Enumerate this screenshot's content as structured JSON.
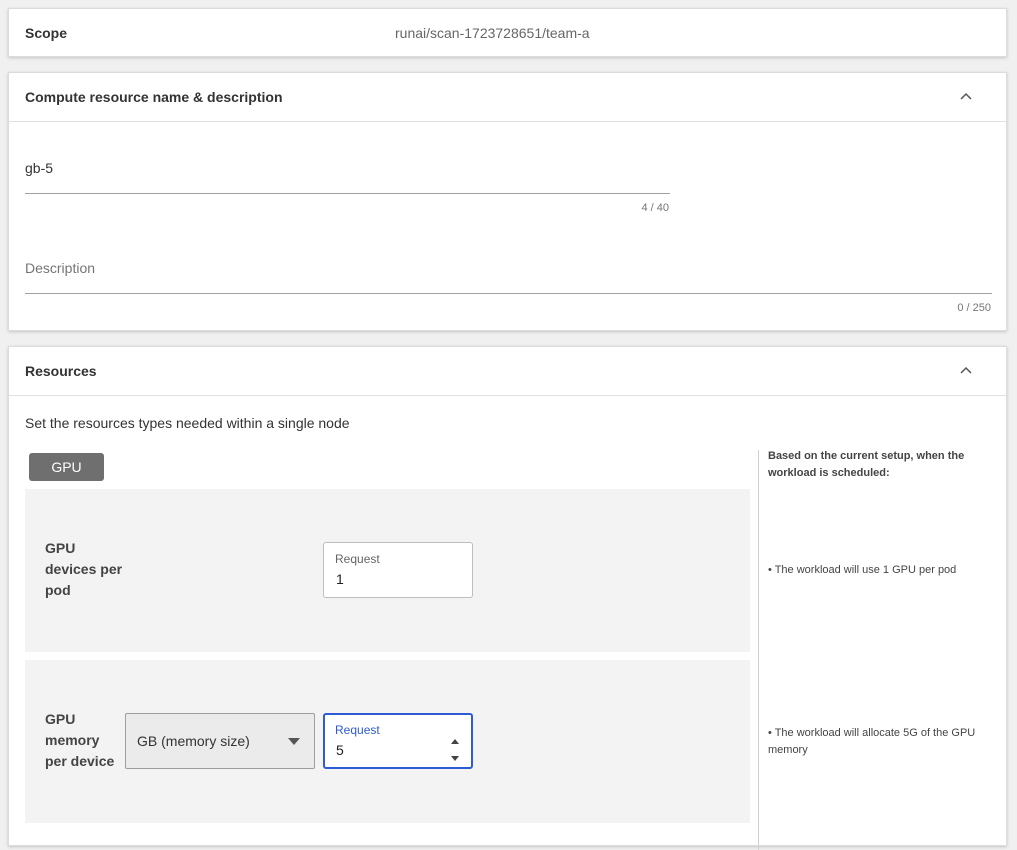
{
  "scope": {
    "label": "Scope",
    "value": "runai/scan-1723728651/team-a"
  },
  "name_section": {
    "title": "Compute resource name & description",
    "name_value": "gb-5",
    "name_counter": "4 / 40",
    "description_placeholder": "Description",
    "description_counter": "0 / 250"
  },
  "resources": {
    "title": "Resources",
    "intro": "Set the resources types needed within a single node",
    "tab_label": "GPU",
    "devices": {
      "label_line1": "GPU",
      "label_line2": "devices per",
      "label_line3": "pod",
      "request_label": "Request",
      "request_value": "1"
    },
    "memory": {
      "label_line1": "GPU",
      "label_line2": "memory",
      "label_line3": "per device",
      "unit_selected": "GB (memory size)",
      "request_label": "Request",
      "request_value": "5"
    },
    "summary": {
      "heading": "Based on the current setup, when the workload is scheduled:",
      "devices_note": "• The workload will use 1 GPU per pod",
      "memory_note": "• The workload will allocate 5G of the GPU memory"
    }
  },
  "colors": {
    "focus_blue": "#2d5bd4",
    "chip_gray": "#6f6f6f",
    "panel_bg": "#f3f3f3"
  },
  "icons": {
    "collapse": "chevron-up-icon",
    "dropdown": "caret-down-icon",
    "spinner": "spinner-arrows-icon"
  }
}
